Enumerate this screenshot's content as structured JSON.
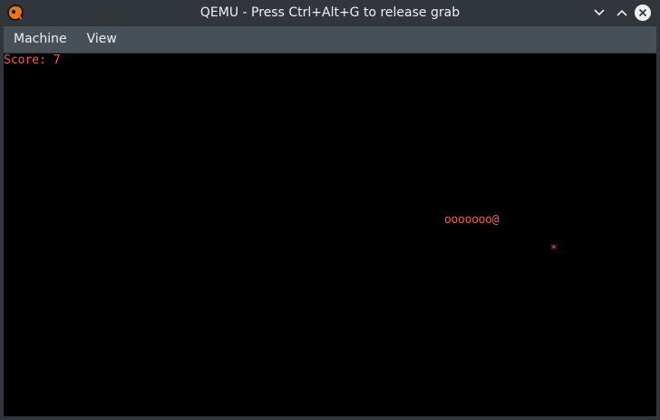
{
  "window": {
    "title": "QEMU - Press Ctrl+Alt+G to release grab",
    "icon": "qemu-logo-icon",
    "controls": [
      "minimize-icon",
      "maximize-icon",
      "close-icon"
    ]
  },
  "menubar": {
    "items": [
      {
        "label": "Machine"
      },
      {
        "label": "View"
      }
    ]
  },
  "game": {
    "score_text": "Score: 7",
    "snake_text": "ooooooo@",
    "food_text": "*",
    "text_color": "#ff5555",
    "background": "#000000"
  }
}
